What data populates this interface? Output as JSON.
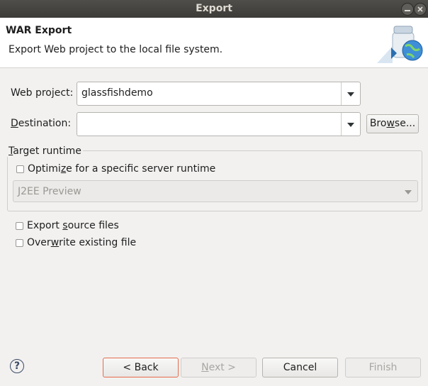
{
  "window": {
    "title": "Export"
  },
  "banner": {
    "title": "WAR Export",
    "description": "Export Web project to the local file system."
  },
  "form": {
    "web_project_label": "Web project:",
    "web_project_value": "glassfishdemo",
    "destination_label": "Destination:",
    "destination_value": "",
    "browse_label": "Browse..."
  },
  "target_runtime": {
    "group_title": "Target runtime",
    "optimize_label": "Optimize for a specific server runtime",
    "optimize_checked": false,
    "runtime_value": "J2EE Preview"
  },
  "options": {
    "export_source_label": "Export source files",
    "export_source_checked": false,
    "overwrite_label": "Overwrite existing file",
    "overwrite_checked": false
  },
  "footer": {
    "back_label": "< Back",
    "next_label": "Next >",
    "cancel_label": "Cancel",
    "finish_label": "Finish"
  },
  "icons": [
    "minimize-icon",
    "close-icon",
    "jar-globe-icon",
    "help-icon",
    "dropdown-arrow-icon"
  ]
}
